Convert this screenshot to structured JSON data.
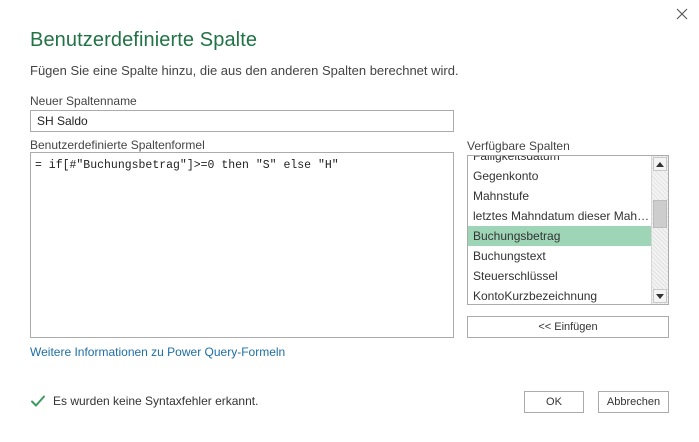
{
  "dialog": {
    "title": "Benutzerdefinierte Spalte",
    "subtitle": "Fügen Sie eine Spalte hinzu, die aus den anderen Spalten berechnet wird.",
    "close_icon": "close-icon"
  },
  "name_field": {
    "label": "Neuer Spaltenname",
    "value": "SH Saldo"
  },
  "formula": {
    "label": "Benutzerdefinierte Spaltenformel",
    "value": "= if[#\"Buchungsbetrag\"]>=0 then \"S\" else \"H\""
  },
  "columns": {
    "label": "Verfügbare Spalten",
    "items": [
      "Fälligkeitsdatum",
      "Gegenkonto",
      "Mahnstufe",
      "letztes Mahndatum dieser Mahnung",
      "Buchungsbetrag",
      "Buchungstext",
      "Steuerschlüssel",
      "KontoKurzbezeichnung"
    ],
    "selected": "Buchungsbetrag",
    "selection_color": "#9fd5b7",
    "insert_button": "<< Einfügen"
  },
  "help_link": "Weitere Informationen zu Power Query-Formeln",
  "status": {
    "text": "Es wurden keine Syntaxfehler erkannt.",
    "icon": "checkmark-icon",
    "icon_color": "#3c9a5f"
  },
  "buttons": {
    "ok": "OK",
    "cancel": "Abbrechen"
  },
  "theme": {
    "accent": "#217346",
    "link": "#1e6ea7"
  }
}
